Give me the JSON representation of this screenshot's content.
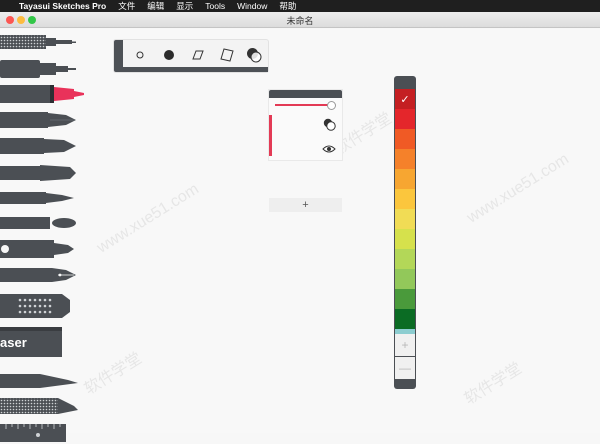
{
  "menubar": {
    "apple": "",
    "app_name": "Tayasui Sketches Pro",
    "items": [
      "文件",
      "编辑",
      "显示",
      "Tools",
      "Window",
      "帮助"
    ]
  },
  "window": {
    "title": "未命名"
  },
  "tools": [
    "pencil-mesh",
    "technical-pen",
    "marker",
    "brush-flat",
    "brush-round",
    "brush-wide",
    "brush-fine",
    "brush-detail",
    "airbrush",
    "fountain-pen",
    "pattern-tool",
    "eraser",
    "cutter",
    "texture-tool",
    "ruler"
  ],
  "eraser_label": "aser",
  "shapes": [
    "circle-outline",
    "circle-filled",
    "parallelogram",
    "square-rotated",
    "overlap-circles"
  ],
  "layers": {
    "add_label": "+"
  },
  "palette": {
    "selected_mark": "✓",
    "colors": [
      "#c41f22",
      "#e4262b",
      "#f05a25",
      "#f5812a",
      "#f7a631",
      "#fbc63d",
      "#f1dc55",
      "#d6e14c",
      "#b3d758",
      "#92c85a",
      "#4a9a3b",
      "#0b6c24",
      "#8ccdd0"
    ],
    "add_label": "+",
    "remove_label": "—"
  },
  "watermark": [
    "www.xue51.com",
    "软件学堂"
  ]
}
